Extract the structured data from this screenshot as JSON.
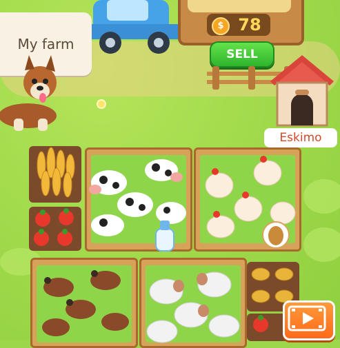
{
  "farm": {
    "title": "My farm"
  },
  "shop": {
    "coins": "78",
    "coin_symbol": "$",
    "sell_label": "SELL"
  },
  "dog": {
    "name": "Eskimo"
  },
  "icons": {
    "video": "video-play-icon",
    "coin": "coin-icon",
    "milk": "milk-bottle-icon",
    "egg": "egg-icon"
  },
  "colors": {
    "accent_sell": "#2fb42c",
    "label_text": "#d14a2a",
    "coin": "#f6a623",
    "video_button": "#ff6a1a"
  }
}
